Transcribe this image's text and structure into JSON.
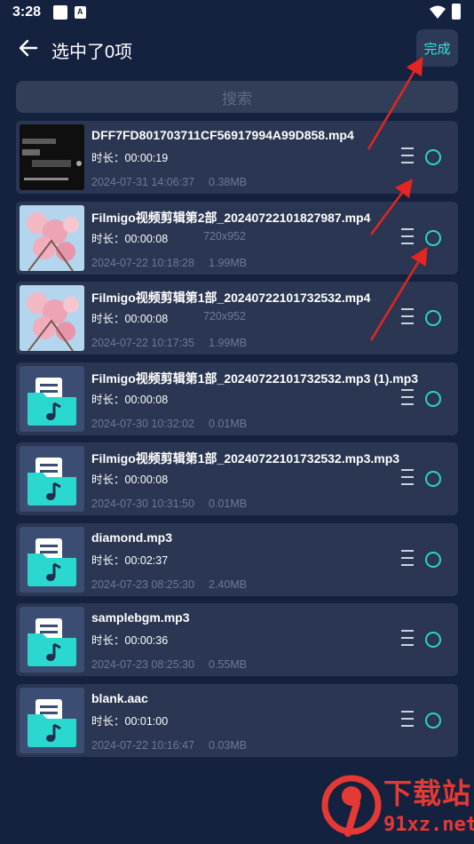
{
  "status_bar": {
    "time": "3:28"
  },
  "header": {
    "title": "选中了0项",
    "done_label": "完成"
  },
  "search": {
    "placeholder": "搜索"
  },
  "colors": {
    "background": "#15223f",
    "card": "#2a3652",
    "accent": "#39e1d8",
    "muted_text": "#6f7b93",
    "annotation_arrow": "#e52521"
  },
  "files": [
    {
      "name": "DFF7FD801703711CF56917994A99D858.mp4",
      "duration_label": "时长：",
      "duration": "00:00:19",
      "resolution": "",
      "date": "2024-07-31 14:06:37",
      "size": "0.38MB",
      "thumbnail": "video-dark"
    },
    {
      "name": "Filmigo视频剪辑第2部_20240722101827987.mp4",
      "duration_label": "时长：",
      "duration": "00:00:08",
      "resolution": "720x952",
      "date": "2024-07-22 10:18:28",
      "size": "1.99MB",
      "thumbnail": "video-flower"
    },
    {
      "name": "Filmigo视频剪辑第1部_20240722101732532.mp4",
      "duration_label": "时长：",
      "duration": "00:00:08",
      "resolution": "720x952",
      "date": "2024-07-22 10:17:35",
      "size": "1.99MB",
      "thumbnail": "video-flower"
    },
    {
      "name": "Filmigo视频剪辑第1部_20240722101732532.mp3 (1).mp3",
      "duration_label": "时长：",
      "duration": "00:00:08",
      "resolution": "",
      "date": "2024-07-30 10:32:02",
      "size": "0.01MB",
      "thumbnail": "audio"
    },
    {
      "name": "Filmigo视频剪辑第1部_20240722101732532.mp3.mp3",
      "duration_label": "时长：",
      "duration": "00:00:08",
      "resolution": "",
      "date": "2024-07-30 10:31:50",
      "size": "0.01MB",
      "thumbnail": "audio"
    },
    {
      "name": "diamond.mp3",
      "duration_label": "时长：",
      "duration": "00:02:37",
      "resolution": "",
      "date": "2024-07-23 08:25:30",
      "size": "2.40MB",
      "thumbnail": "audio"
    },
    {
      "name": "samplebgm.mp3",
      "duration_label": "时长：",
      "duration": "00:00:36",
      "resolution": "",
      "date": "2024-07-23 08:25:30",
      "size": "0.55MB",
      "thumbnail": "audio"
    },
    {
      "name": "blank.aac",
      "duration_label": "时长：",
      "duration": "00:01:00",
      "resolution": "",
      "date": "2024-07-22 10:16:47",
      "size": "0.03MB",
      "thumbnail": "audio"
    }
  ],
  "watermark": {
    "top_text": "下载站",
    "bottom_text": "91xz.net"
  }
}
